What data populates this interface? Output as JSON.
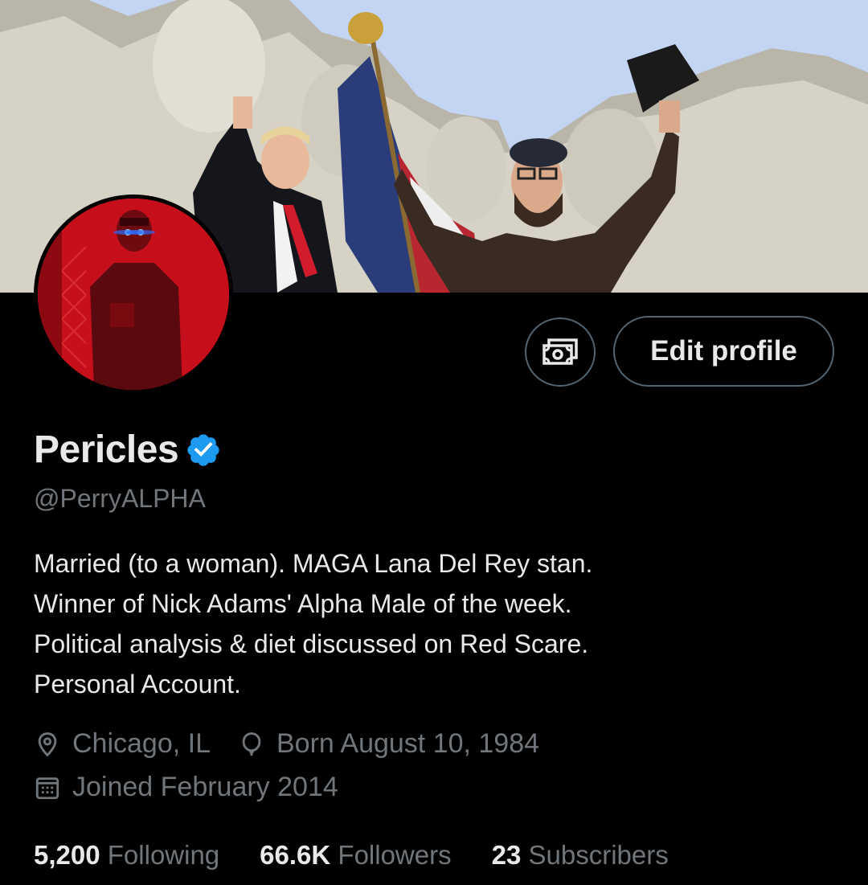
{
  "profile": {
    "display_name": "Pericles",
    "handle": "@PerryALPHA",
    "verified_icon": "verified-badge-icon",
    "bio_lines": [
      "Married (to a woman). MAGA Lana Del Rey stan.",
      "Winner of Nick Adams' Alpha Male of the week.",
      "Political analysis & diet discussed on Red Scare.",
      "Personal Account."
    ],
    "location": "Chicago, IL",
    "birthday": "Born August 10, 1984",
    "joined": "Joined February 2014"
  },
  "actions": {
    "money_icon": "money-icon",
    "edit_profile_label": "Edit profile"
  },
  "stats": {
    "following_count": "5,200",
    "following_label": "Following",
    "followers_count": "66.6K",
    "followers_label": "Followers",
    "subscribers_count": "23",
    "subscribers_label": "Subscribers"
  },
  "colors": {
    "background": "#000000",
    "primary_text": "#e7e9ea",
    "secondary_text": "#71767b",
    "border": "#536471",
    "verified_blue": "#1d9bf0",
    "avatar_red": "#c0101a",
    "banner_sky": "#c9d8f2"
  }
}
